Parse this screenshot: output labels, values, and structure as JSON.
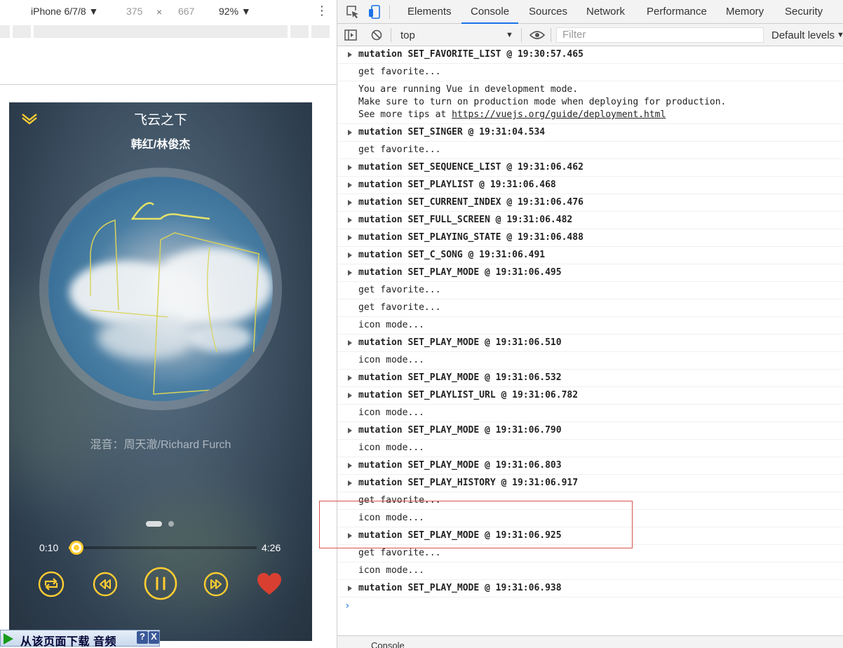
{
  "device_toolbar": {
    "device": "iPhone 6/7/8 ▼",
    "width": "375",
    "times": "×",
    "height": "667",
    "zoom": "92% ▼",
    "more": "⋮"
  },
  "player": {
    "title": "飞云之下",
    "singer": "韩红/林俊杰",
    "lyric": "混音：周天澈/Richard Furch",
    "current_time": "0:10",
    "total_time": "4:26",
    "progress": 0.04,
    "favorite": true,
    "accent_color": "#ffcd32",
    "heart_color": "#d93f30"
  },
  "banner": {
    "text": "从该页面下载 音频",
    "help": "?",
    "close": "X"
  },
  "devtools": {
    "tabs": [
      "Elements",
      "Console",
      "Sources",
      "Network",
      "Performance",
      "Memory",
      "Security"
    ],
    "active_tab": "Console",
    "context": "top",
    "filter_placeholder": "Filter",
    "levels": "Default levels",
    "bottom_tab": "Console"
  },
  "console_rows": [
    {
      "type": "m",
      "text": "mutation SET_FAVORITE_LIST @ 19:30:57.465"
    },
    {
      "type": "log",
      "text": "get favorite..."
    },
    {
      "type": "vue",
      "lines": [
        "You are running Vue in development mode.",
        "Make sure to turn on production mode when deploying for production.",
        "See more tips at "
      ],
      "link": "https://vuejs.org/guide/deployment.html"
    },
    {
      "type": "m",
      "text": "mutation SET_SINGER @ 19:31:04.534"
    },
    {
      "type": "log",
      "text": "get favorite..."
    },
    {
      "type": "m",
      "text": "mutation SET_SEQUENCE_LIST @ 19:31:06.462"
    },
    {
      "type": "m",
      "text": "mutation SET_PLAYLIST @ 19:31:06.468"
    },
    {
      "type": "m",
      "text": "mutation SET_CURRENT_INDEX @ 19:31:06.476"
    },
    {
      "type": "m",
      "text": "mutation SET_FULL_SCREEN @ 19:31:06.482"
    },
    {
      "type": "m",
      "text": "mutation SET_PLAYING_STATE @ 19:31:06.488"
    },
    {
      "type": "m",
      "text": "mutation SET_C_SONG @ 19:31:06.491"
    },
    {
      "type": "m",
      "text": "mutation SET_PLAY_MODE @ 19:31:06.495"
    },
    {
      "type": "log",
      "text": "get favorite..."
    },
    {
      "type": "log",
      "text": "get favorite..."
    },
    {
      "type": "log",
      "text": "icon mode..."
    },
    {
      "type": "m",
      "text": "mutation SET_PLAY_MODE @ 19:31:06.510"
    },
    {
      "type": "log",
      "text": "icon mode..."
    },
    {
      "type": "m",
      "text": "mutation SET_PLAY_MODE @ 19:31:06.532"
    },
    {
      "type": "m",
      "text": "mutation SET_PLAYLIST_URL @ 19:31:06.782"
    },
    {
      "type": "log",
      "text": "icon mode..."
    },
    {
      "type": "m",
      "text": "mutation SET_PLAY_MODE @ 19:31:06.790"
    },
    {
      "type": "log",
      "text": "icon mode..."
    },
    {
      "type": "m",
      "text": "mutation SET_PLAY_MODE @ 19:31:06.803"
    },
    {
      "type": "m",
      "text": "mutation SET_PLAY_HISTORY @ 19:31:06.917"
    },
    {
      "type": "log",
      "text": "get favorite..."
    },
    {
      "type": "log",
      "text": "icon mode..."
    },
    {
      "type": "m",
      "text": "mutation SET_PLAY_MODE @ 19:31:06.925"
    },
    {
      "type": "log",
      "text": "get favorite..."
    },
    {
      "type": "log",
      "text": "icon mode..."
    },
    {
      "type": "m",
      "text": "mutation SET_PLAY_MODE @ 19:31:06.938"
    }
  ],
  "prompt": "›"
}
